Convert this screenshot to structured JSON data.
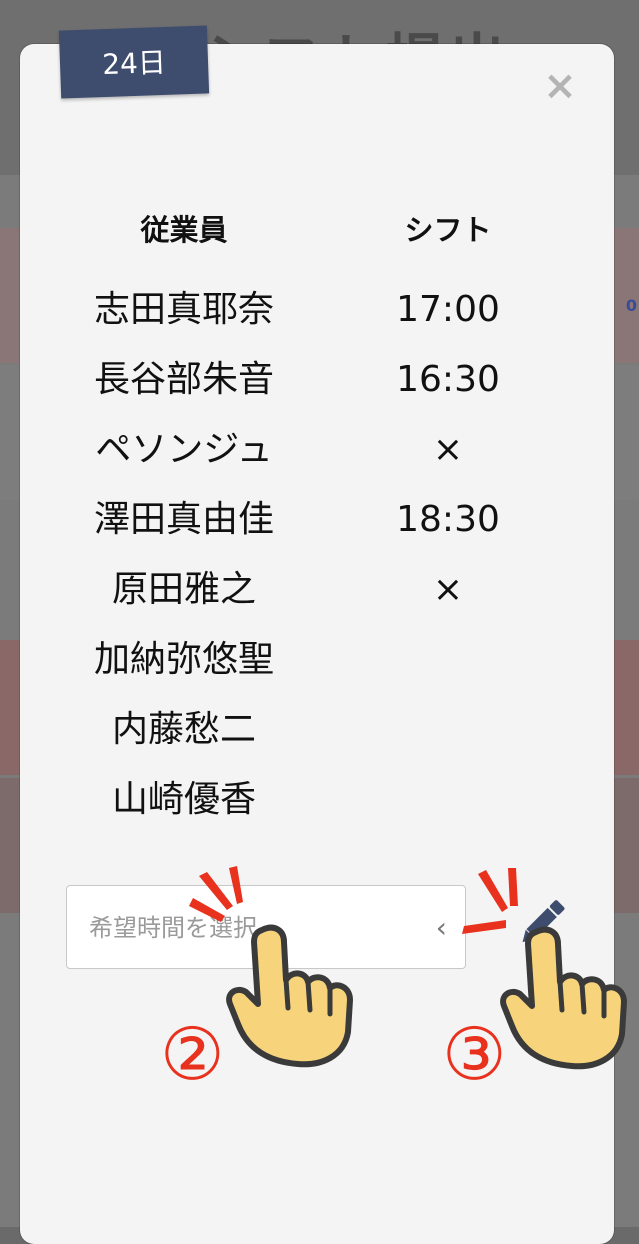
{
  "background": {
    "title": "シフト提出",
    "side_value": "0"
  },
  "modal": {
    "date": "24日",
    "close_symbol": "×",
    "headers": {
      "employee": "従業員",
      "shift": "シフト"
    },
    "rows": [
      {
        "name": "志田真耶奈",
        "shift": "17:00"
      },
      {
        "name": "長谷部朱音",
        "shift": "16:30"
      },
      {
        "name": "ペソンジュ",
        "shift": "×"
      },
      {
        "name": "澤田真由佳",
        "shift": "18:30"
      },
      {
        "name": "原田雅之",
        "shift": "×"
      },
      {
        "name": "加納弥悠聖",
        "shift": ""
      },
      {
        "name": "内藤愁二",
        "shift": ""
      },
      {
        "name": "山崎優香",
        "shift": ""
      }
    ],
    "time_select": {
      "placeholder": "希望時間を選択",
      "chevron": "‹"
    }
  },
  "annotations": {
    "step2": "②",
    "step3": "③"
  },
  "colors": {
    "tag_bg": "#3e4d6e",
    "accent_red": "#e8321e",
    "hand_fill": "#f7d47c",
    "pencil": "#3e4d6e"
  }
}
